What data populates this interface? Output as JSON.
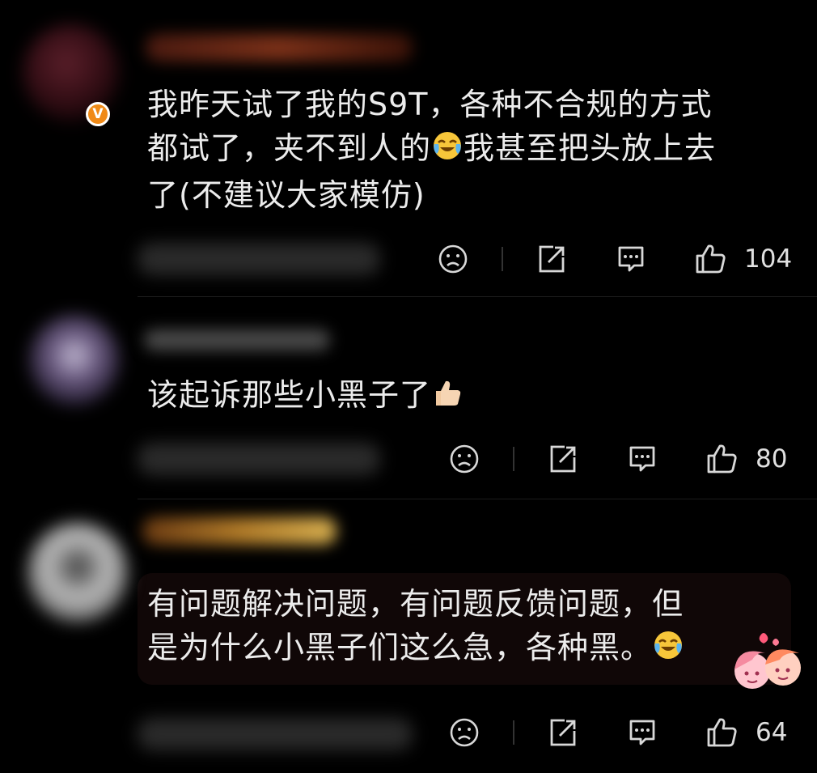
{
  "comments": [
    {
      "text_lines": [
        "我昨天试了我的S9T，各种不合规的方式",
        "都试了，夹不到人的",
        "我甚至把头放上去",
        "了(不建议大家模仿)"
      ],
      "emoji": "laugh-cry-emoji",
      "likes": "104",
      "verified": "V"
    },
    {
      "text_lines": [
        "该起诉那些小黑子了"
      ],
      "emoji": "thumbs-up-emoji",
      "likes": "80"
    },
    {
      "text_lines": [
        "有问题解决问题，有问题反馈问题，但",
        "是为什么小黑子们这么急，各种黑。"
      ],
      "emoji": "laugh-cry-emoji",
      "likes": "64",
      "decoration": "couple-hearts-sticker"
    }
  ],
  "icons": {
    "dislike": "sad-face-icon",
    "share": "share-icon",
    "reply": "comment-bubble-icon",
    "like": "thumbs-up-icon"
  },
  "colors": {
    "background": "#000000",
    "text": "#ececec",
    "icon": "#d8d8d8",
    "verified_badge": "#f08a18"
  }
}
